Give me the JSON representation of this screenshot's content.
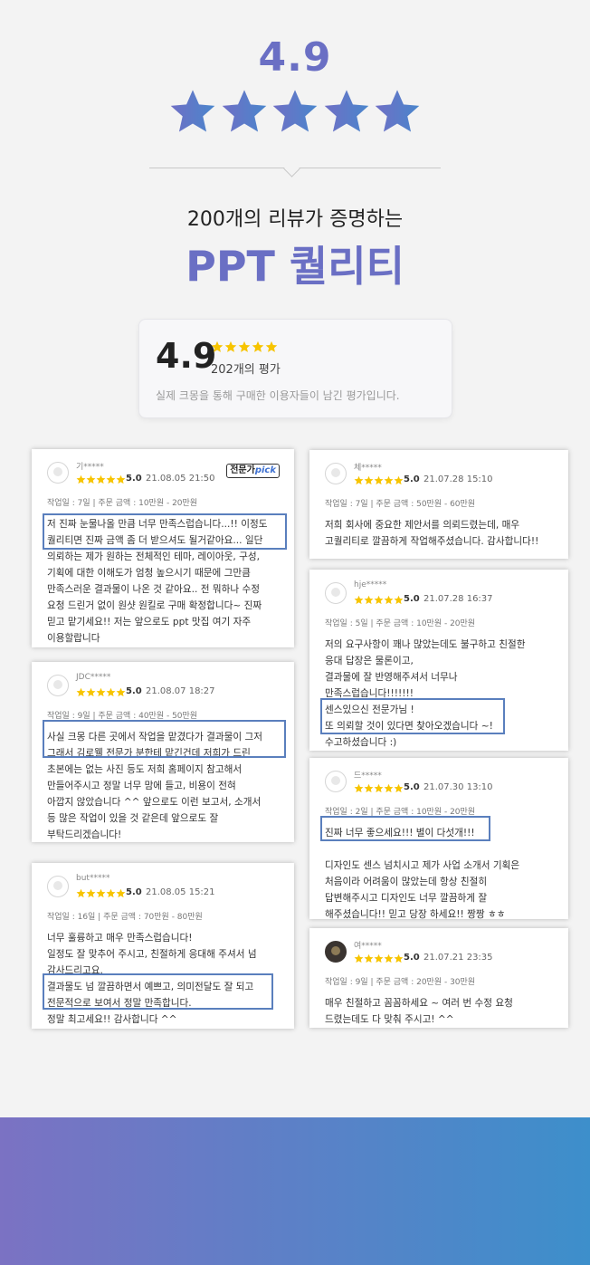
{
  "hero": {
    "rating": "4.9",
    "subtitle": "200개의 리뷰가 증명하는",
    "title": "PPT 퀄리티"
  },
  "summary": {
    "score": "4.9",
    "star_count": 5,
    "count": "202개의 평가",
    "note": "실제 크몽을 통해 구매한 이용자들이 남긴 평가입니다."
  },
  "colors": {
    "accent": "#6a6fc4",
    "star": "#f7c400",
    "highlight": "#5a7fbd",
    "band_start": "#7b72c3",
    "band_end": "#3d8fcb"
  },
  "reviews": [
    {
      "name": "기*****",
      "score": "5.0",
      "date": "21.08.05 21:50",
      "badge": "전문가",
      "badge_em": "pick",
      "meta": "작업일 : 7일 | 주문 금액 : 10만원 - 20만원",
      "lines": [
        "저 진짜 눈물나올 만큼 너무 만족스럽습니다...!! 이정도",
        "퀄리티면 진짜 금액 좀 더 받으셔도 될거같아요... 일단",
        "의뢰하는 제가 원하는 전체적인 테마, 레이아웃, 구성,",
        "기획에 대한 이해도가 엄청 높으시기 때문에 그만큼",
        "만족스러운 결과물이 나온 것 같아요.. 전 뭐하나 수정",
        "요청 드린거 없이 원샷 원킬로 구매 확정합니다~ 진짜",
        "믿고 맡기세요!! 저는 앞으로도 ppt 맛집 여기 자주",
        "이용할랍니다"
      ]
    },
    {
      "name": "JDC*****",
      "score": "5.0",
      "date": "21.08.07 18:27",
      "meta": "작업일 : 9일 | 주문 금액 : 40만원 - 50만원",
      "lines": [
        "사실 크몽 다른 곳에서 작업을 맡겼다가 결과물이 그저",
        "그래서 김로웰 전문가 분한테 맡긴건데 저희가 드린",
        "초본에는 없는 사진 등도 저희 홈페이지 참고해서",
        "만들어주시고 정말 너무 맘에 들고, 비용이 전혀",
        "아깝지 않았습니다 ^^ 앞으로도 이런 보고서, 소개서",
        "등 많은 작업이 있을 것 같은데 앞으로도 잘",
        "부탁드리겠습니다!"
      ]
    },
    {
      "name": "but*****",
      "score": "5.0",
      "date": "21.08.05 15:21",
      "meta": "작업일 : 16일 | 주문 금액 : 70만원 - 80만원",
      "lines": [
        "너무 훌륭하고 매우 만족스럽습니다!",
        "일정도 잘 맞추어 주시고, 친절하게 응대해 주셔서 넘",
        "감사드리고요.",
        "결과물도 넘 깔끔하면서 예쁘고, 의미전달도 잘 되고",
        "전문적으로 보여서 정말 만족합니다.",
        "정말 최고세요!! 감사합니다 ^^"
      ]
    },
    {
      "name": "체*****",
      "score": "5.0",
      "date": "21.07.28 15:10",
      "meta": "작업일 : 7일 | 주문 금액 : 50만원 - 60만원",
      "lines": [
        "저희 회사에 중요한 제안서를 의뢰드렸는데, 매우",
        "고퀄리티로 깔끔하게 작업해주셨습니다. 감사합니다!!"
      ]
    },
    {
      "name": "hje*****",
      "score": "5.0",
      "date": "21.07.28 16:37",
      "meta": "작업일 : 5일 | 주문 금액 : 10만원 - 20만원",
      "lines": [
        "저의 요구사항이 꽤나 많았는데도 불구하고 친절한",
        "응대 답장은 물론이고,",
        "결과물에 잘 반영해주셔서 너무나",
        "만족스럽습니다!!!!!!!",
        "센스있으신 전문가님 !",
        "또 의뢰할 것이 있다면 찾아오겠습니다 ~!",
        "수고하셨습니다 :)"
      ]
    },
    {
      "name": "드*****",
      "score": "5.0",
      "date": "21.07.30 13:10",
      "meta": "작업일 : 2일 | 주문 금액 : 10만원 - 20만원",
      "lines": [
        "진짜 너무 좋으세요!!!  별이 다섯개!!!",
        "",
        "디자인도 센스 넘치시고 제가 사업 소개서 기획은",
        "처음이라 어려움이 많았는데 항상 친절히",
        "답변해주시고 디자인도 너무 깔끔하게 잘",
        "해주셨습니다!! 믿고 당장 하세요!! 짱짱 ㅎㅎ"
      ]
    },
    {
      "name": "여*****",
      "score": "5.0",
      "date": "21.07.21 23:35",
      "meta": "작업일 : 9일 | 주문 금액 : 20만원 - 30만원",
      "lines": [
        "매우 친절하고 꼼꼼하세요 ~  여러 번 수정 요청",
        "드렸는데도 다 맞춰 주시고!  ^^"
      ]
    }
  ]
}
